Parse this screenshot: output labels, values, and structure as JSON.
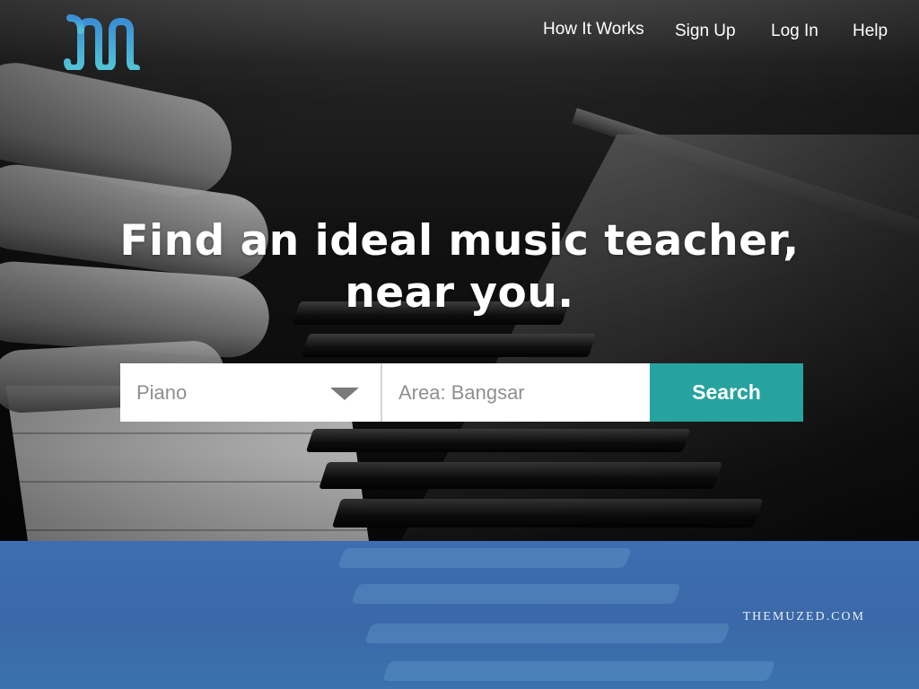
{
  "brand": {
    "logo_icon": "muzed-m-logo-icon",
    "logo_color": "#4fa3d8"
  },
  "nav": {
    "items": [
      {
        "label": "How It Works"
      },
      {
        "label": "Sign Up"
      },
      {
        "label": "Log In"
      },
      {
        "label": "Help"
      }
    ]
  },
  "hero": {
    "headline_line1": "Find an ideal music teacher,",
    "headline_line2": "near you.",
    "background_icon": "piano-keys-photo"
  },
  "search": {
    "instrument_value": "Piano",
    "area_placeholder": "Area: Bangsar",
    "search_label": "Search",
    "button_color": "#26a39e"
  },
  "footer": {
    "domain": "THEMUZED.COM",
    "band_color": "#3d6eb0"
  }
}
